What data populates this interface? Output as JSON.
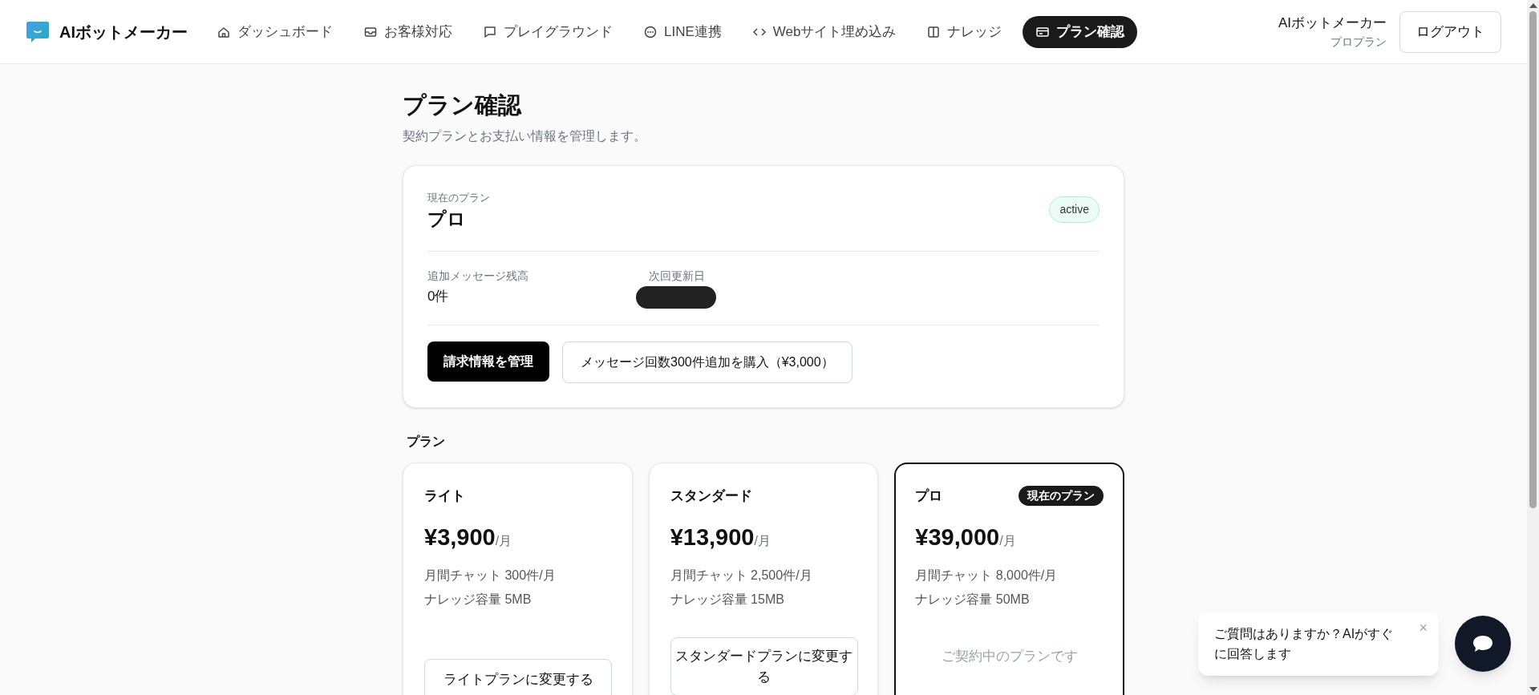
{
  "brand": "AIボットメーカー",
  "nav": [
    {
      "label": "ダッシュボード",
      "selected": false
    },
    {
      "label": "お客様対応",
      "selected": false
    },
    {
      "label": "プレイグラウンド",
      "selected": false
    },
    {
      "label": "LINE連携",
      "selected": false
    },
    {
      "label": "Webサイト埋め込み",
      "selected": false
    },
    {
      "label": "ナレッジ",
      "selected": false
    },
    {
      "label": "プラン確認",
      "selected": true
    }
  ],
  "user": {
    "name": "AIボットメーカー",
    "plan": "プロプラン"
  },
  "logout": "ログアウト",
  "page": {
    "title": "プラン確認",
    "subtitle": "契約プランとお支払い情報を管理します。"
  },
  "current_plan": {
    "label": "現在のプラン",
    "name": "プロ",
    "status": "active",
    "stats": [
      {
        "label": "追加メッセージ残高",
        "value": "0件",
        "redacted": false
      },
      {
        "label": "次回更新日",
        "redacted": true
      }
    ],
    "buttons": [
      {
        "label": "請求情報を管理",
        "primary": true
      },
      {
        "label": "メッセージ回数300件追加を購入（¥3,000）",
        "primary": false
      }
    ]
  },
  "plans_heading": "プラン",
  "plans": [
    {
      "name": "ライト",
      "price": "¥3,900",
      "unit": "/月",
      "features": [
        "月間チャット 300件/月",
        "ナレッジ容量 5MB"
      ],
      "current": false,
      "action": "ライトプランに変更する"
    },
    {
      "name": "スタンダード",
      "price": "¥13,900",
      "unit": "/月",
      "features": [
        "月間チャット 2,500件/月",
        "ナレッジ容量 15MB"
      ],
      "current": false,
      "action": "スタンダードプランに変更する"
    },
    {
      "name": "プロ",
      "price": "¥39,000",
      "unit": "/月",
      "features": [
        "月間チャット 8,000件/月",
        "ナレッジ容量 50MB"
      ],
      "current": true,
      "badge": "現在のプラン",
      "action": "ご契約中のプランです"
    }
  ],
  "chat_popup": {
    "message": "ご質問はありますか？AIがすぐに回答します",
    "close": "×"
  }
}
